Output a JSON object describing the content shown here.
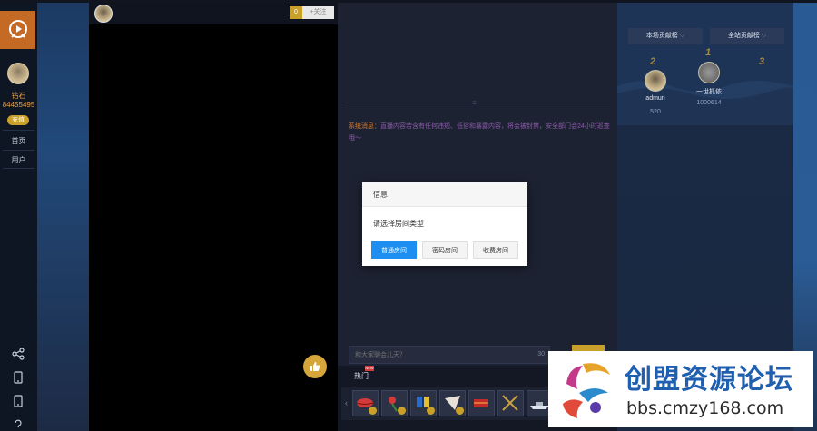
{
  "sidebar": {
    "rank_label": "钻石",
    "user_number": "84455495",
    "level_badge": "充值",
    "nav": [
      "首页",
      "用户"
    ],
    "icons": [
      "share-icon",
      "mobile-icon",
      "mobile-icon",
      "help-icon"
    ]
  },
  "video": {
    "follow_count": "0",
    "follow_label": "+关注"
  },
  "chat": {
    "system_label": "系统消息：",
    "system_text": "直播内容若含有任何违规、低俗和暴露内容，将会被封禁，安全部门会24小时巡查哦～",
    "input_placeholder": "和大家聊会儿天？",
    "input_counter": "30",
    "hot_tab": "热门",
    "hot_badge": "NEW"
  },
  "ranking": {
    "tab_room": "本场贡献榜",
    "tab_site": "全站贡献榜",
    "entries": [
      {
        "rank": "2",
        "name": "admun",
        "score": "520"
      },
      {
        "rank": "1",
        "name": "一世抓依",
        "score": "1000614"
      },
      {
        "rank": "3",
        "name": "",
        "score": ""
      }
    ]
  },
  "dialog": {
    "title": "信息",
    "message": "请选择房间类型",
    "buttons": [
      "普通房间",
      "密码房间",
      "收费房间"
    ]
  },
  "watermark": {
    "title": "创盟资源论坛",
    "url": "bbs.cmzy168.com"
  },
  "colors": {
    "accent_gold": "#c8a02a",
    "primary_blue": "#1e8ef0",
    "logo_orange": "#c56a24"
  }
}
